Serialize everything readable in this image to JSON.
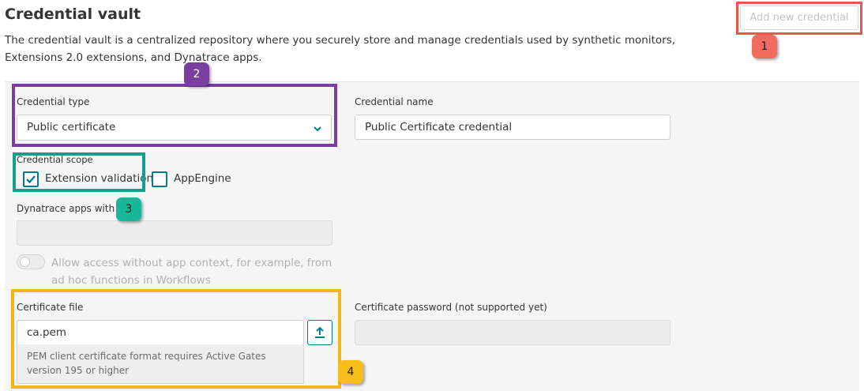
{
  "header": {
    "title": "Credential vault",
    "description": "The credential vault is a centralized repository where you securely store and manage credentials used by synthetic monitors, Extensions 2.0 extensions, and Dynatrace apps.",
    "add_button_label": "Add new credential"
  },
  "form": {
    "credential_type": {
      "label": "Credential type",
      "value": "Public certificate",
      "icon": "chevron-down-icon"
    },
    "credential_name": {
      "label": "Credential name",
      "value": "Public Certificate credential"
    },
    "credential_scope": {
      "label": "Credential scope",
      "options": [
        {
          "label": "Extension validation",
          "checked": true
        },
        {
          "label": "AppEngine",
          "checked": false
        }
      ]
    },
    "apps_with_access": {
      "label": "Dynatrace apps with ac",
      "value": ""
    },
    "toggle": {
      "label": "Allow access without app context, for example, from ad hoc functions in Workflows",
      "on": false
    },
    "certificate_file": {
      "label": "Certificate file",
      "value": "ca.pem",
      "upload_icon": "upload-icon",
      "hint": "PEM client certificate format requires Active Gates version 195 or higher"
    },
    "certificate_password": {
      "label": "Certificate password (not supported yet)",
      "value": ""
    }
  },
  "annotations": {
    "badges": [
      "1",
      "2",
      "3",
      "4"
    ],
    "colors": {
      "red": "#e8584f",
      "purple": "#7a3f9e",
      "teal": "#14a088",
      "yellow": "#f2b51a"
    }
  },
  "colors": {
    "accent": "#007e8a"
  }
}
